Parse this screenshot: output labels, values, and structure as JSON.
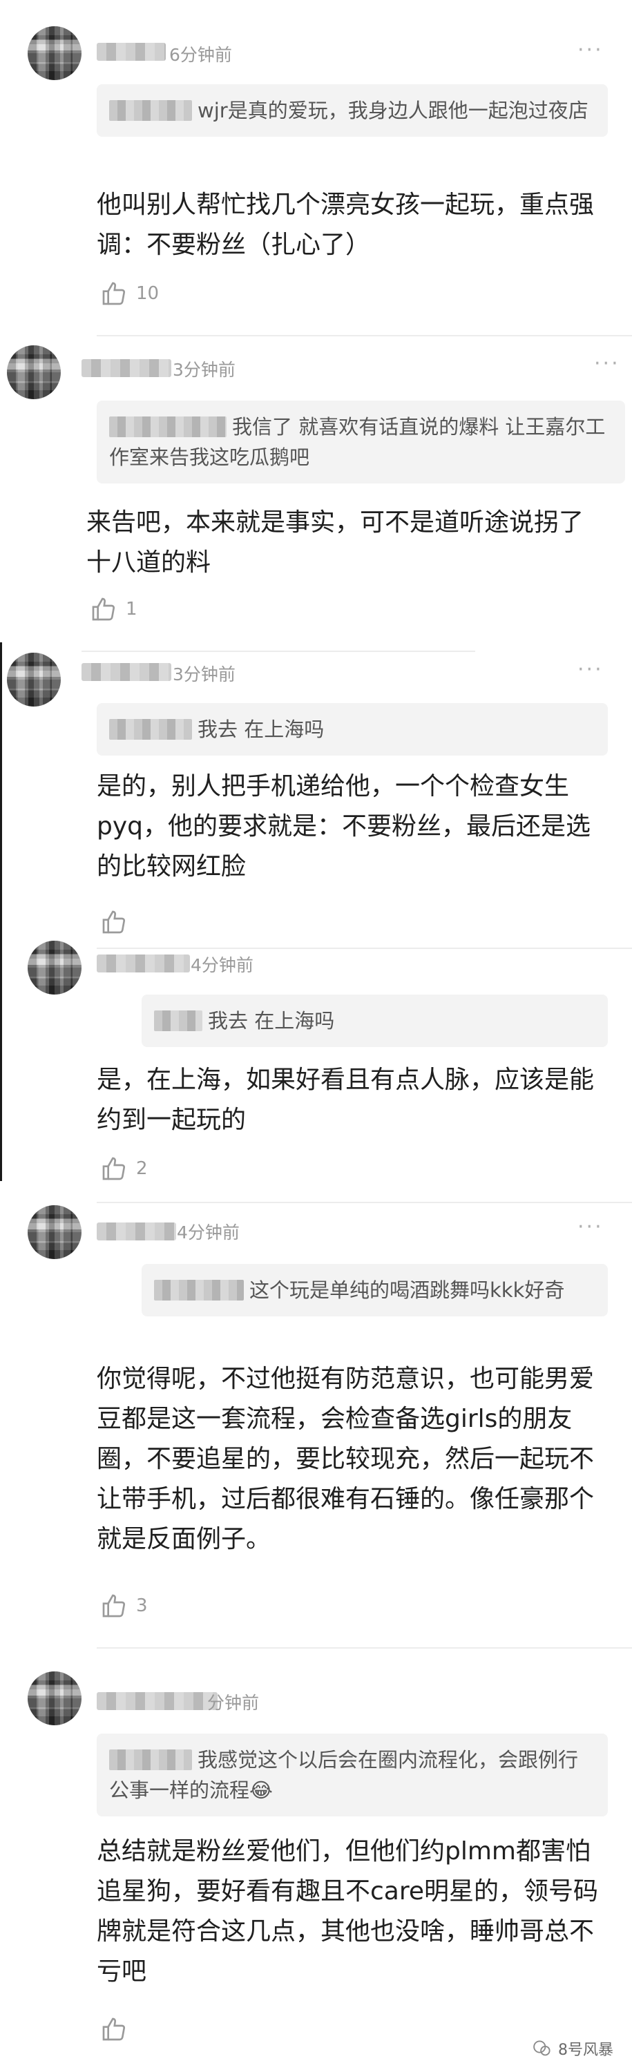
{
  "comments": [
    {
      "time": "6分钟前",
      "quote_visible": "wjr是真的爱玩，我身边人跟他一起泡过夜店",
      "reply": "他叫别人帮忙找几个漂亮女孩一起玩，重点强调：不要粉丝（扎心了）",
      "likes": "10"
    },
    {
      "time": "3分钟前",
      "quote_visible": "我信了 就喜欢有话直说的爆料 让王嘉尔工作室来告我这吃瓜鹅吧",
      "reply": "来告吧，本来就是事实，可不是道听途说拐了十八道的料",
      "likes": "1"
    },
    {
      "time": "3分钟前",
      "quote_visible": "我去 在上海吗",
      "reply": "是的，别人把手机递给他，一个个检查女生pyq，他的要求就是：不要粉丝，最后还是选的比较网红脸",
      "likes": ""
    },
    {
      "time": "4分钟前",
      "quote_visible": "我去 在上海吗",
      "reply": "是，在上海，如果好看且有点人脉，应该是能约到一起玩的",
      "likes": "2"
    },
    {
      "time": "4分钟前",
      "quote_visible": "这个玩是单纯的喝酒跳舞吗kkk好奇",
      "reply": "你觉得呢，不过他挺有防范意识，也可能男爱豆都是这一套流程，会检查备选girls的朋友圈，不要追星的，要比较现充，然后一起玩不让带手机，过后都很难有石锤的。像任豪那个就是反面例子。",
      "likes": "3"
    },
    {
      "time": "分钟前",
      "quote_visible": "我感觉这个以后会在圈内流程化，会跟例行公事一样的流程😂",
      "reply": "总结就是粉丝爱他们，但他们约plmm都害怕追星狗，要好看有趣且不care明星的，领号码牌就是符合这几点，其他也没啥，睡帅哥总不亏吧",
      "likes": ""
    }
  ],
  "more_label": "···",
  "watermark": "8号风暴",
  "colors": {
    "time": "#9a9a9a",
    "quote_bg": "#f3f3f3",
    "text": "#1f1f1f"
  }
}
